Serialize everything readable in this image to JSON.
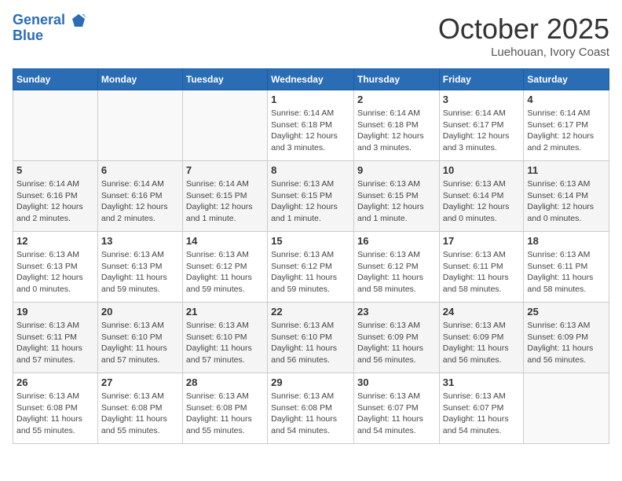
{
  "header": {
    "logo_line1": "General",
    "logo_line2": "Blue",
    "month": "October 2025",
    "location": "Luehouan, Ivory Coast"
  },
  "weekdays": [
    "Sunday",
    "Monday",
    "Tuesday",
    "Wednesday",
    "Thursday",
    "Friday",
    "Saturday"
  ],
  "weeks": [
    [
      {
        "day": "",
        "info": ""
      },
      {
        "day": "",
        "info": ""
      },
      {
        "day": "",
        "info": ""
      },
      {
        "day": "1",
        "info": "Sunrise: 6:14 AM\nSunset: 6:18 PM\nDaylight: 12 hours\nand 3 minutes."
      },
      {
        "day": "2",
        "info": "Sunrise: 6:14 AM\nSunset: 6:18 PM\nDaylight: 12 hours\nand 3 minutes."
      },
      {
        "day": "3",
        "info": "Sunrise: 6:14 AM\nSunset: 6:17 PM\nDaylight: 12 hours\nand 3 minutes."
      },
      {
        "day": "4",
        "info": "Sunrise: 6:14 AM\nSunset: 6:17 PM\nDaylight: 12 hours\nand 2 minutes."
      }
    ],
    [
      {
        "day": "5",
        "info": "Sunrise: 6:14 AM\nSunset: 6:16 PM\nDaylight: 12 hours\nand 2 minutes."
      },
      {
        "day": "6",
        "info": "Sunrise: 6:14 AM\nSunset: 6:16 PM\nDaylight: 12 hours\nand 2 minutes."
      },
      {
        "day": "7",
        "info": "Sunrise: 6:14 AM\nSunset: 6:15 PM\nDaylight: 12 hours\nand 1 minute."
      },
      {
        "day": "8",
        "info": "Sunrise: 6:13 AM\nSunset: 6:15 PM\nDaylight: 12 hours\nand 1 minute."
      },
      {
        "day": "9",
        "info": "Sunrise: 6:13 AM\nSunset: 6:15 PM\nDaylight: 12 hours\nand 1 minute."
      },
      {
        "day": "10",
        "info": "Sunrise: 6:13 AM\nSunset: 6:14 PM\nDaylight: 12 hours\nand 0 minutes."
      },
      {
        "day": "11",
        "info": "Sunrise: 6:13 AM\nSunset: 6:14 PM\nDaylight: 12 hours\nand 0 minutes."
      }
    ],
    [
      {
        "day": "12",
        "info": "Sunrise: 6:13 AM\nSunset: 6:13 PM\nDaylight: 12 hours\nand 0 minutes."
      },
      {
        "day": "13",
        "info": "Sunrise: 6:13 AM\nSunset: 6:13 PM\nDaylight: 11 hours\nand 59 minutes."
      },
      {
        "day": "14",
        "info": "Sunrise: 6:13 AM\nSunset: 6:12 PM\nDaylight: 11 hours\nand 59 minutes."
      },
      {
        "day": "15",
        "info": "Sunrise: 6:13 AM\nSunset: 6:12 PM\nDaylight: 11 hours\nand 59 minutes."
      },
      {
        "day": "16",
        "info": "Sunrise: 6:13 AM\nSunset: 6:12 PM\nDaylight: 11 hours\nand 58 minutes."
      },
      {
        "day": "17",
        "info": "Sunrise: 6:13 AM\nSunset: 6:11 PM\nDaylight: 11 hours\nand 58 minutes."
      },
      {
        "day": "18",
        "info": "Sunrise: 6:13 AM\nSunset: 6:11 PM\nDaylight: 11 hours\nand 58 minutes."
      }
    ],
    [
      {
        "day": "19",
        "info": "Sunrise: 6:13 AM\nSunset: 6:11 PM\nDaylight: 11 hours\nand 57 minutes."
      },
      {
        "day": "20",
        "info": "Sunrise: 6:13 AM\nSunset: 6:10 PM\nDaylight: 11 hours\nand 57 minutes."
      },
      {
        "day": "21",
        "info": "Sunrise: 6:13 AM\nSunset: 6:10 PM\nDaylight: 11 hours\nand 57 minutes."
      },
      {
        "day": "22",
        "info": "Sunrise: 6:13 AM\nSunset: 6:10 PM\nDaylight: 11 hours\nand 56 minutes."
      },
      {
        "day": "23",
        "info": "Sunrise: 6:13 AM\nSunset: 6:09 PM\nDaylight: 11 hours\nand 56 minutes."
      },
      {
        "day": "24",
        "info": "Sunrise: 6:13 AM\nSunset: 6:09 PM\nDaylight: 11 hours\nand 56 minutes."
      },
      {
        "day": "25",
        "info": "Sunrise: 6:13 AM\nSunset: 6:09 PM\nDaylight: 11 hours\nand 56 minutes."
      }
    ],
    [
      {
        "day": "26",
        "info": "Sunrise: 6:13 AM\nSunset: 6:08 PM\nDaylight: 11 hours\nand 55 minutes."
      },
      {
        "day": "27",
        "info": "Sunrise: 6:13 AM\nSunset: 6:08 PM\nDaylight: 11 hours\nand 55 minutes."
      },
      {
        "day": "28",
        "info": "Sunrise: 6:13 AM\nSunset: 6:08 PM\nDaylight: 11 hours\nand 55 minutes."
      },
      {
        "day": "29",
        "info": "Sunrise: 6:13 AM\nSunset: 6:08 PM\nDaylight: 11 hours\nand 54 minutes."
      },
      {
        "day": "30",
        "info": "Sunrise: 6:13 AM\nSunset: 6:07 PM\nDaylight: 11 hours\nand 54 minutes."
      },
      {
        "day": "31",
        "info": "Sunrise: 6:13 AM\nSunset: 6:07 PM\nDaylight: 11 hours\nand 54 minutes."
      },
      {
        "day": "",
        "info": ""
      }
    ]
  ]
}
